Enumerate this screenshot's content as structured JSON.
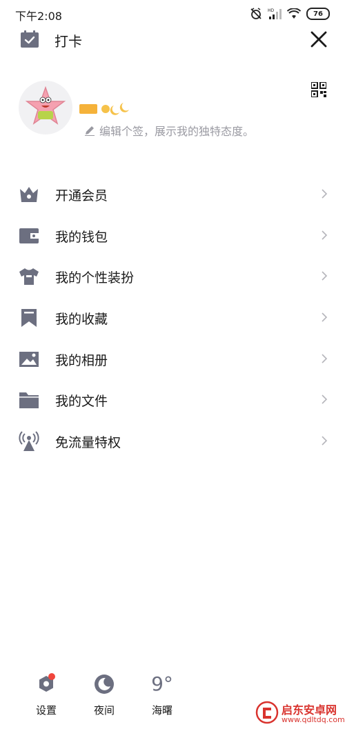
{
  "status_bar": {
    "time": "下午2:08",
    "battery": "76",
    "network_badge": "HD"
  },
  "header": {
    "checkin_label": "打卡"
  },
  "profile": {
    "signature": "编辑个签，展示我的独特态度。"
  },
  "menu": {
    "items": [
      {
        "label": "开通会员",
        "icon": "crown-icon"
      },
      {
        "label": "我的钱包",
        "icon": "wallet-icon"
      },
      {
        "label": "我的个性装扮",
        "icon": "tshirt-icon"
      },
      {
        "label": "我的收藏",
        "icon": "bookmark-icon"
      },
      {
        "label": "我的相册",
        "icon": "image-icon"
      },
      {
        "label": "我的文件",
        "icon": "folder-icon"
      },
      {
        "label": "免流量特权",
        "icon": "signal-tower-icon"
      }
    ]
  },
  "bottom_bar": {
    "settings_label": "设置",
    "night_label": "夜间",
    "weather_temp": "9°",
    "weather_label": "海曙"
  },
  "watermark": {
    "name": "启东安卓网",
    "url": "www.qdltdq.com"
  },
  "colors": {
    "icon": "#6c6f80",
    "text": "#1a1a1a",
    "muted": "#9a9aa2",
    "badge": "#f0453c"
  }
}
